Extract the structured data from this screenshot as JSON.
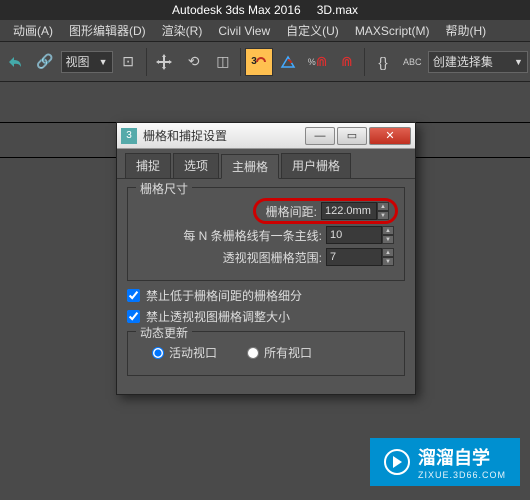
{
  "app": {
    "title_left": "Autodesk 3ds Max 2016",
    "title_right": "3D.max"
  },
  "menu": {
    "animation": "动画(A)",
    "graph_editor": "图形编辑器(D)",
    "render": "渲染(R)",
    "civil_view": "Civil View",
    "customize": "自定义(U)",
    "maxscript": "MAXScript(M)",
    "help": "帮助(H)"
  },
  "toolbar": {
    "view_dropdown": "视图",
    "selection_set": "创建选择集"
  },
  "dialog": {
    "title": "栅格和捕捉设置",
    "tabs": {
      "snaps": "捕捉",
      "options": "选项",
      "home_grid": "主栅格",
      "user_grids": "用户栅格"
    },
    "grid_size_label": "栅格尺寸",
    "grid_spacing_label": "栅格间距:",
    "grid_spacing_value": "122.0mm",
    "major_lines_label": "每 N 条栅格线有一条主线:",
    "major_lines_value": "10",
    "perspective_label": "透视视图栅格范围:",
    "perspective_value": "7",
    "inhibit_sub_label": "禁止低于栅格间距的栅格细分",
    "inhibit_persp_label": "禁止透视视图栅格调整大小",
    "dynamic_update_label": "动态更新",
    "active_viewport": "活动视口",
    "all_viewports": "所有视口"
  },
  "watermark": {
    "main": "溜溜自学",
    "sub": "ZIXUE.3D66.COM"
  }
}
